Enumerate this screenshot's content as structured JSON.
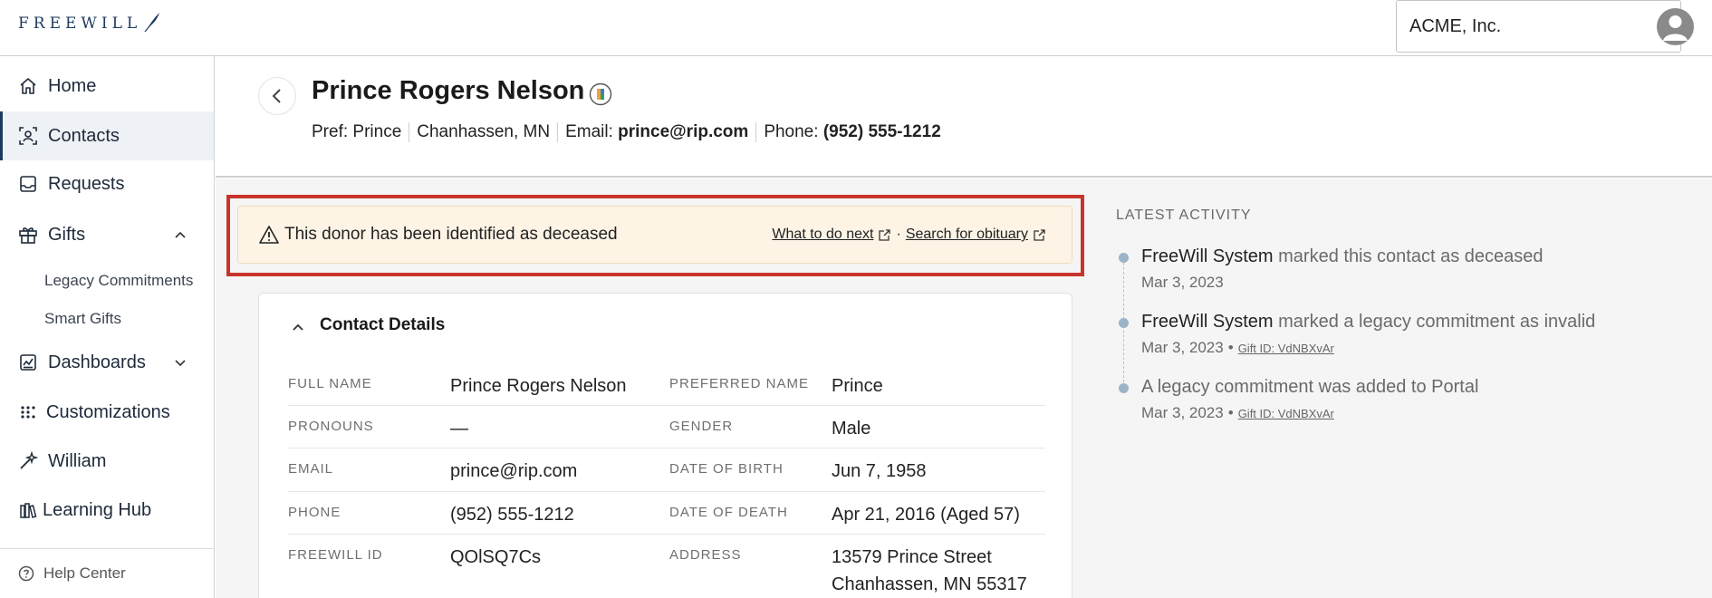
{
  "app": {
    "logo_text": "FREEWILL",
    "org_select": {
      "value": "ACME, Inc."
    }
  },
  "sidebar": {
    "items": [
      {
        "label": "Home",
        "icon": "home-icon"
      },
      {
        "label": "Contacts",
        "icon": "contacts-icon",
        "active": true
      },
      {
        "label": "Requests",
        "icon": "inbox-icon"
      },
      {
        "label": "Gifts",
        "icon": "gift-icon",
        "expanded": true
      },
      {
        "label": "Dashboards",
        "icon": "chart-icon",
        "expanded": false
      },
      {
        "label": "Customizations",
        "icon": "customize-icon"
      },
      {
        "label": "William",
        "icon": "sparkle-icon"
      },
      {
        "label": "Learning Hub",
        "icon": "books-icon"
      }
    ],
    "gifts_subitems": [
      "Legacy Commitments",
      "Smart Gifts"
    ],
    "help_label": "Help Center"
  },
  "contact": {
    "name": "Prince Rogers Nelson",
    "pref": "Pref: Prince",
    "location": "Chanhassen, MN",
    "email_label": "Email:",
    "email": "prince@rip.com",
    "phone_label": "Phone:",
    "phone": "(952) 555-1212"
  },
  "alert": {
    "text": "This donor has been identified as deceased",
    "link1": "What to do next",
    "separator": "·",
    "link2": "Search for obituary"
  },
  "details": {
    "title": "Contact Details",
    "rows": [
      {
        "l1": "FULL NAME",
        "v1": "Prince Rogers Nelson",
        "l2": "PREFERRED NAME",
        "v2": "Prince"
      },
      {
        "l1": "PRONOUNS",
        "v1": "—",
        "l2": "GENDER",
        "v2": "Male"
      },
      {
        "l1": "EMAIL",
        "v1": "prince@rip.com",
        "l2": "DATE OF BIRTH",
        "v2": "Jun 7, 1958"
      },
      {
        "l1": "PHONE",
        "v1": "(952) 555-1212",
        "l2": "DATE OF DEATH",
        "v2": "Apr 21, 2016 (Aged 57)"
      },
      {
        "l1": "FREEWILL ID",
        "v1": "QOlSQ7Cs",
        "l2": "ADDRESS",
        "v2": "13579 Prince Street",
        "v2b": "Chanhassen, MN 55317"
      }
    ]
  },
  "activity": {
    "heading": "LATEST ACTIVITY",
    "items": [
      {
        "actor": "FreeWill System",
        "action": " marked this contact as deceased",
        "date": "Mar 3, 2023"
      },
      {
        "actor": "FreeWill System",
        "action": " marked a legacy commitment as invalid",
        "date": "Mar 3, 2023",
        "bullet": "•",
        "gift": "Gift ID: VdNBXvAr"
      },
      {
        "actor": "",
        "action": "A legacy commitment was added to Portal",
        "date": "Mar 3, 2023",
        "bullet": "•",
        "gift": "Gift ID: VdNBXvAr"
      }
    ]
  },
  "colors": {
    "brand": "#1e3a5f",
    "alert_bg": "#fdf4e6",
    "highlight_outline": "#c8342b",
    "timeline_dot": "#9db3c6"
  }
}
